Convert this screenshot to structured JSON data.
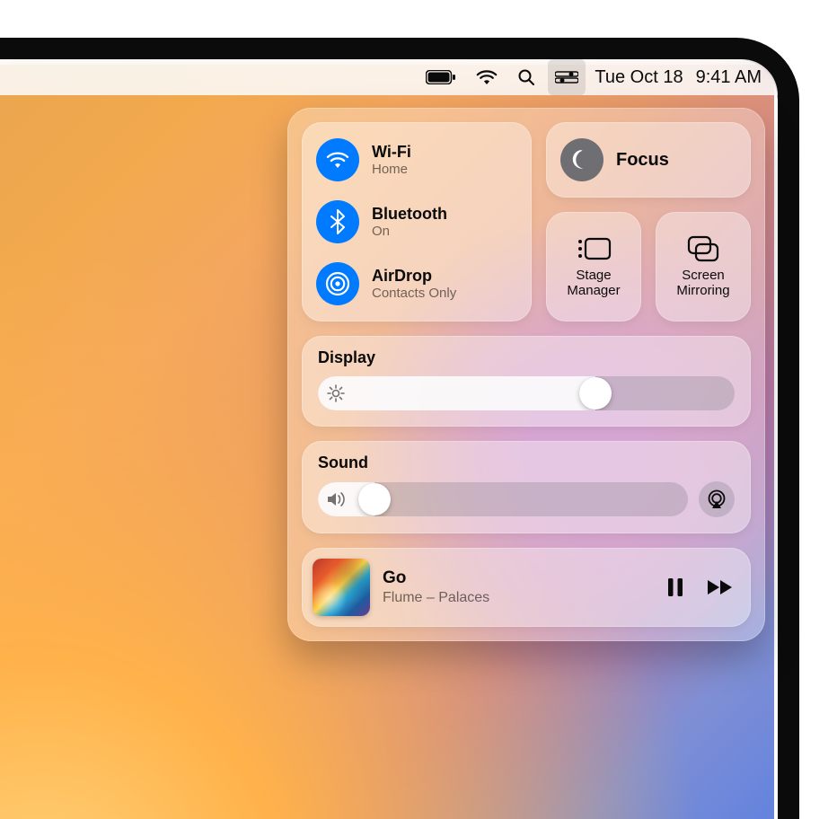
{
  "menubar": {
    "date": "Tue Oct 18",
    "time": "9:41 AM"
  },
  "controlCenter": {
    "radios": {
      "wifi": {
        "title": "Wi-Fi",
        "status": "Home",
        "on": true
      },
      "bluetooth": {
        "title": "Bluetooth",
        "status": "On",
        "on": true
      },
      "airdrop": {
        "title": "AirDrop",
        "status": "Contacts Only",
        "on": true
      }
    },
    "focus": {
      "title": "Focus",
      "on": false
    },
    "tiles": {
      "stageManager": "Stage\nManager",
      "screenMirroring": "Screen\nMirroring"
    },
    "display": {
      "title": "Display",
      "brightness_percent": 68
    },
    "sound": {
      "title": "Sound",
      "volume_percent": 12
    },
    "nowPlaying": {
      "title": "Go",
      "subtitle": "Flume – Palaces",
      "playing": true
    }
  },
  "colors": {
    "accent_blue": "#007aff",
    "icon_gray": "#6e6e73"
  }
}
